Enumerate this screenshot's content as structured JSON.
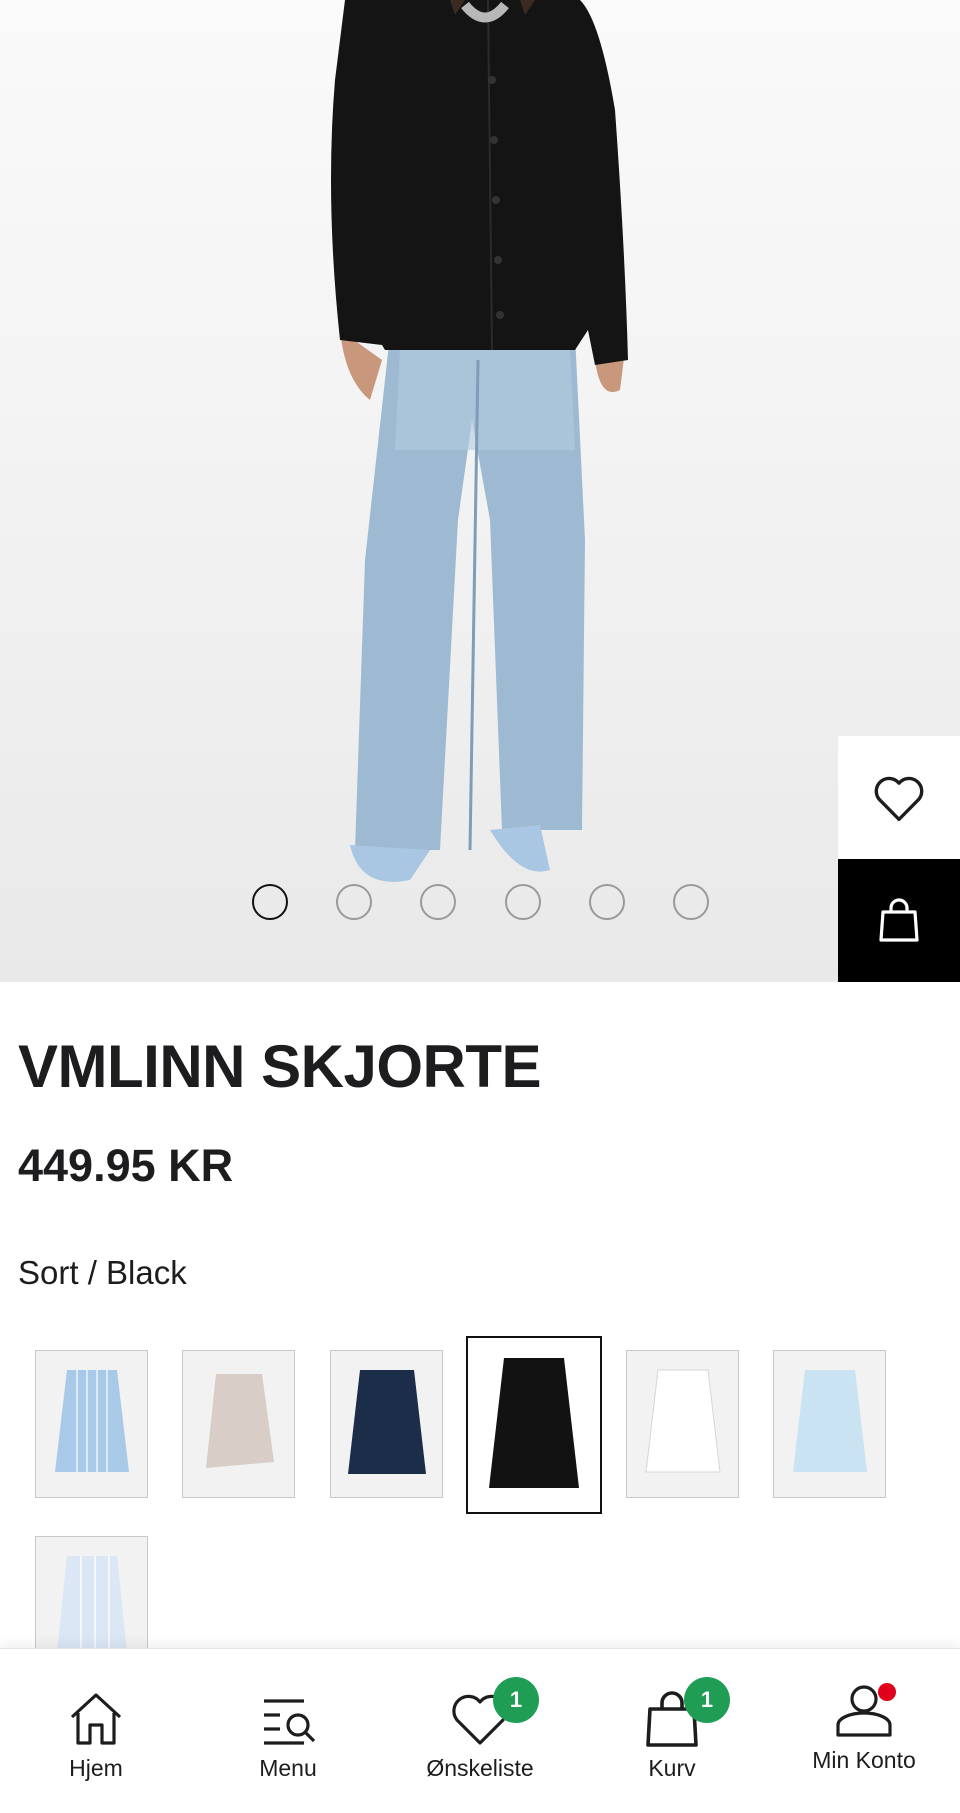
{
  "product": {
    "title": "VMLINN SKJORTE",
    "price": "449.95 KR",
    "color_label": "Sort / Black"
  },
  "gallery": {
    "image_count": 6,
    "active_index": 0
  },
  "swatches": [
    {
      "name": "light blue stripe",
      "color": "#a9c9e8",
      "selected": false
    },
    {
      "name": "beige",
      "color": "#d9cdc7",
      "selected": false
    },
    {
      "name": "navy",
      "color": "#1c2d4a",
      "selected": false
    },
    {
      "name": "black",
      "color": "#121212",
      "selected": true
    },
    {
      "name": "white",
      "color": "#eeeeee",
      "selected": false
    },
    {
      "name": "sky blue",
      "color": "#c9e3f2",
      "selected": false
    },
    {
      "name": "pale blue stripe",
      "color": "#dbe7f5",
      "selected": false
    }
  ],
  "nav": {
    "home": "Hjem",
    "menu": "Menu",
    "wishlist": "Ønskeliste",
    "wishlist_count": "1",
    "cart": "Kurv",
    "cart_count": "1",
    "account": "Min Konto"
  },
  "colors": {
    "badge": "#1f9d55",
    "notification": "#e0001b",
    "text": "#1d1d1f"
  }
}
